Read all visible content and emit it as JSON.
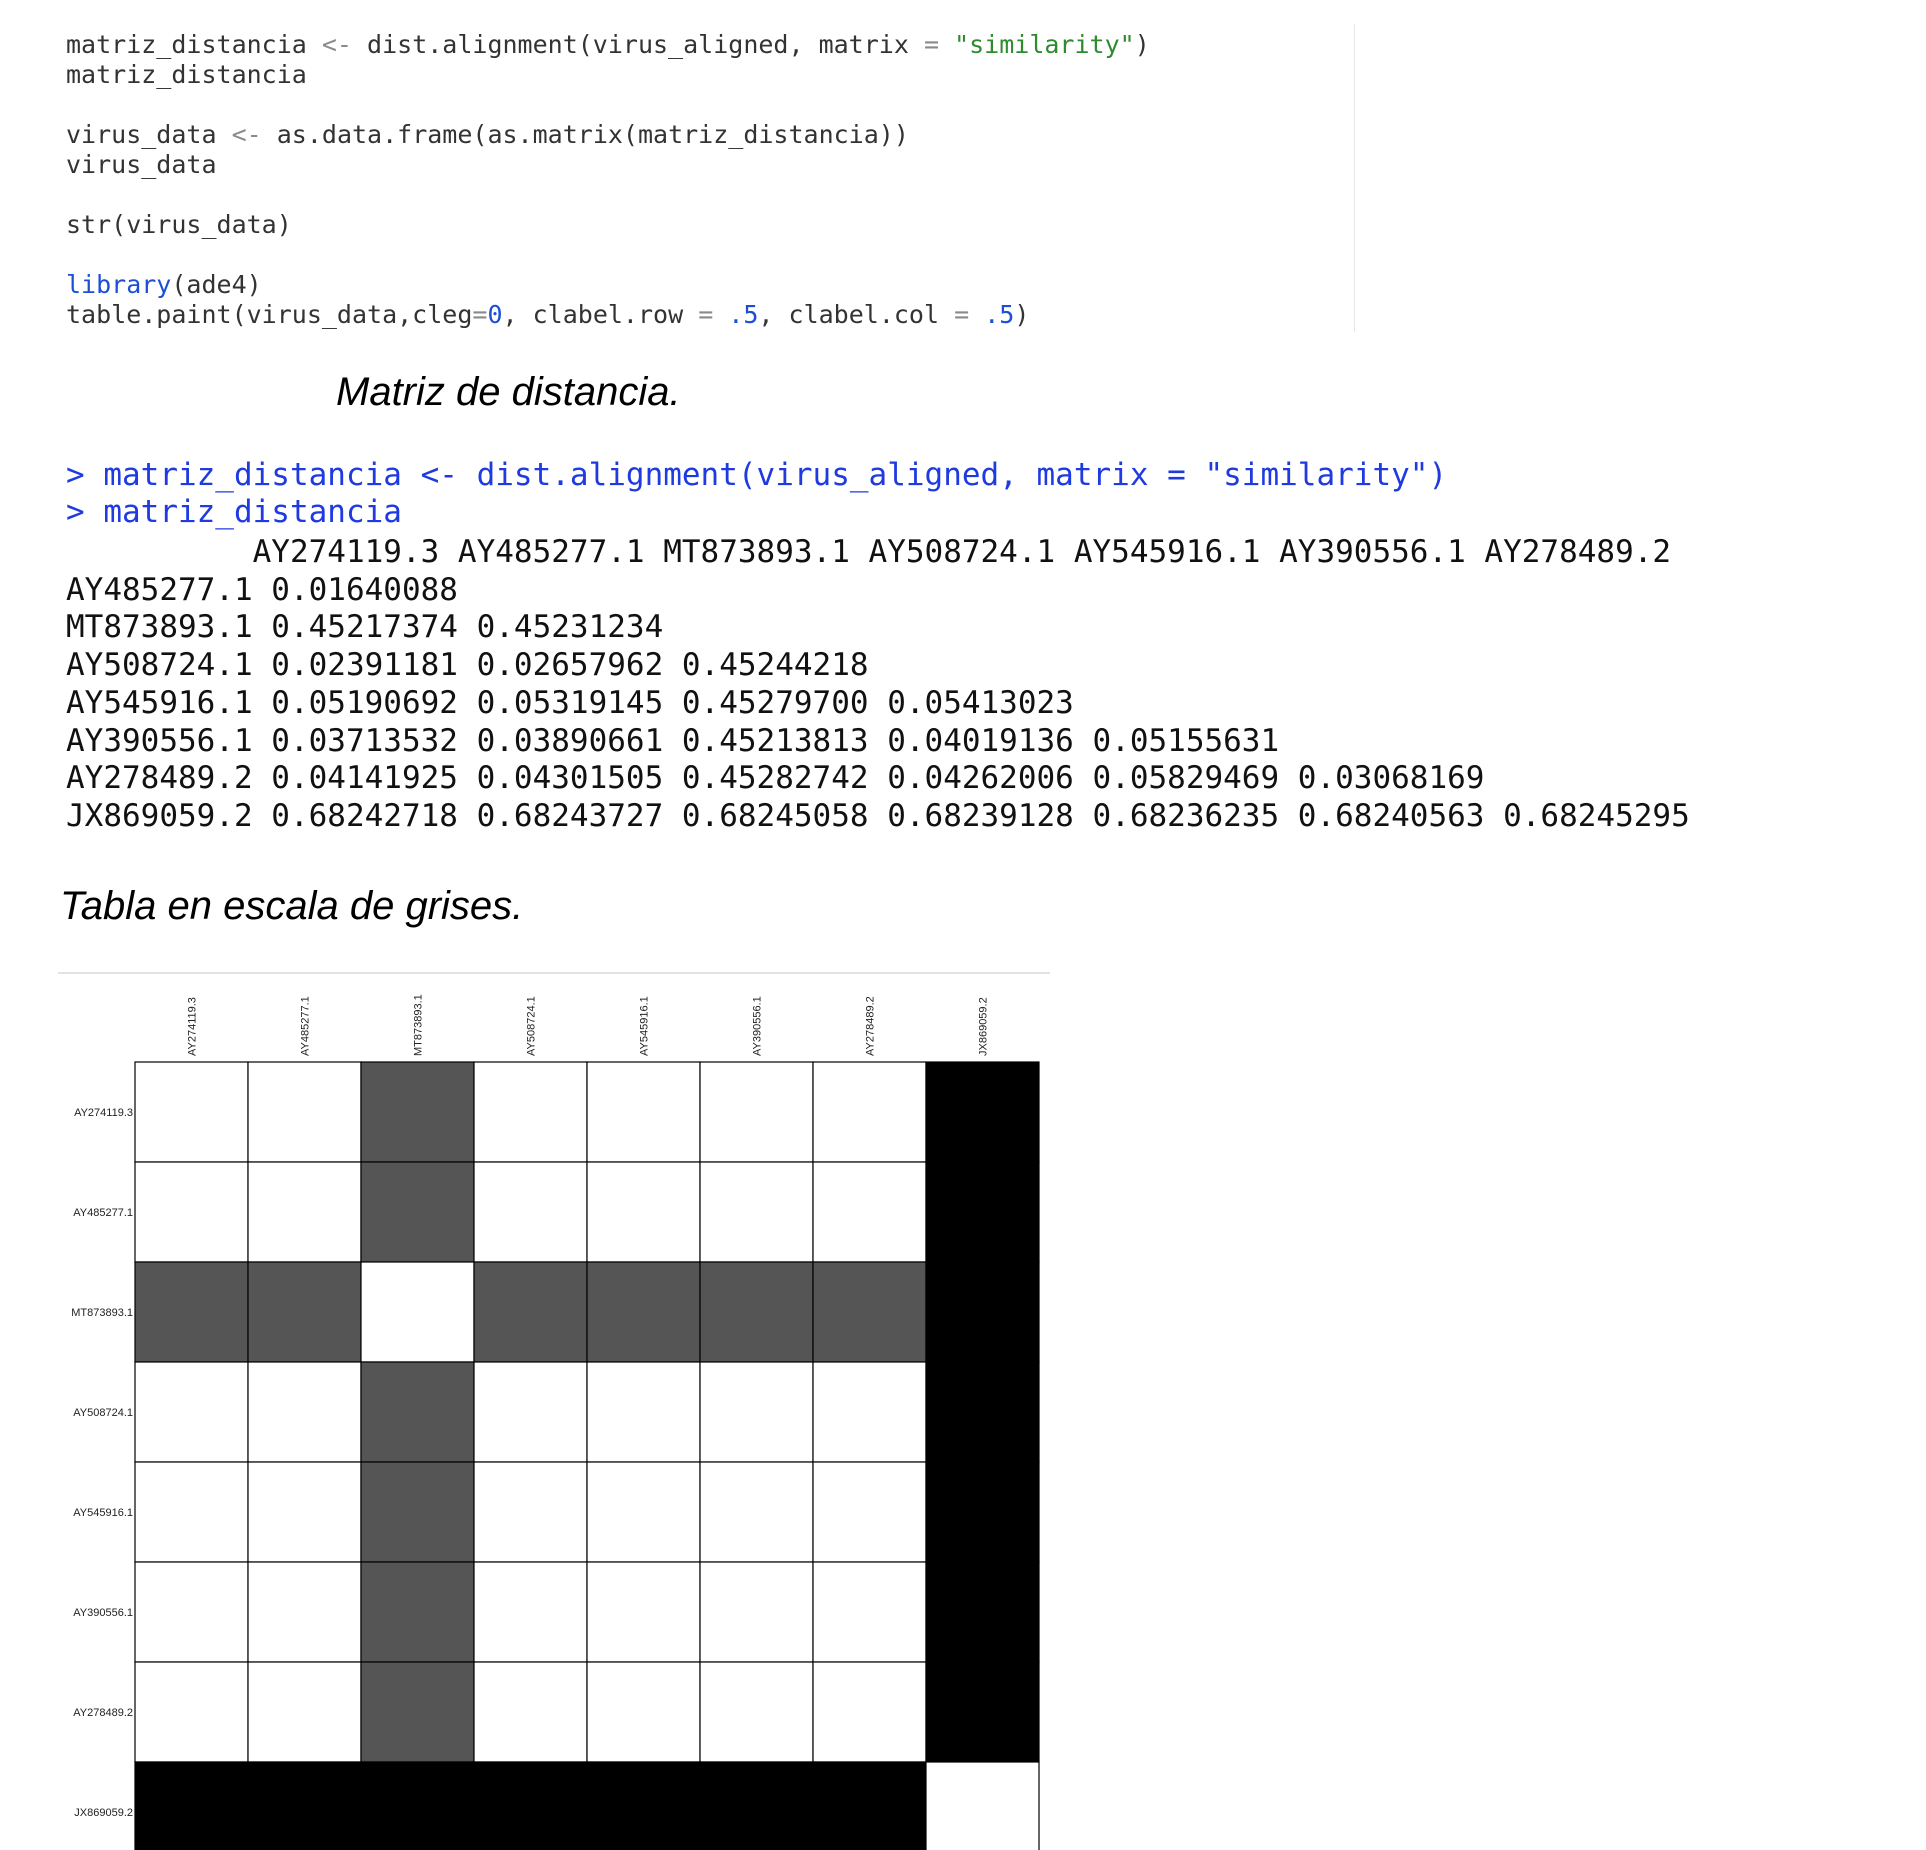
{
  "editor": {
    "lines": [
      {
        "parts": [
          {
            "t": "matriz_distancia ",
            "c": ""
          },
          {
            "t": "<-",
            "c": "tok-op"
          },
          {
            "t": " dist.alignment(virus_aligned, matrix ",
            "c": ""
          },
          {
            "t": "=",
            "c": "tok-op"
          },
          {
            "t": " ",
            "c": ""
          },
          {
            "t": "\"similarity\"",
            "c": "tok-str"
          },
          {
            "t": ")",
            "c": ""
          }
        ]
      },
      {
        "parts": [
          {
            "t": "matriz_distancia",
            "c": ""
          }
        ]
      },
      {
        "parts": []
      },
      {
        "parts": [
          {
            "t": "virus_data ",
            "c": ""
          },
          {
            "t": "<-",
            "c": "tok-op"
          },
          {
            "t": " as.data.frame(as.matrix(matriz_distancia))",
            "c": ""
          }
        ]
      },
      {
        "parts": [
          {
            "t": "virus_data",
            "c": ""
          }
        ]
      },
      {
        "parts": []
      },
      {
        "parts": [
          {
            "t": "str(virus_data)",
            "c": ""
          }
        ]
      },
      {
        "parts": []
      },
      {
        "parts": [
          {
            "t": "library",
            "c": "tok-fn"
          },
          {
            "t": "(ade4)",
            "c": ""
          }
        ]
      },
      {
        "parts": [
          {
            "t": "table.paint(virus_data,cleg",
            "c": ""
          },
          {
            "t": "=",
            "c": "tok-op"
          },
          {
            "t": "0",
            "c": "tok-num"
          },
          {
            "t": ", clabel.row ",
            "c": ""
          },
          {
            "t": "=",
            "c": "tok-op"
          },
          {
            "t": " ",
            "c": ""
          },
          {
            "t": ".5",
            "c": "tok-num"
          },
          {
            "t": ", clabel.col ",
            "c": ""
          },
          {
            "t": "=",
            "c": "tok-op"
          },
          {
            "t": " ",
            "c": ""
          },
          {
            "t": ".5",
            "c": "tok-num"
          },
          {
            "t": ")",
            "c": ""
          }
        ]
      }
    ]
  },
  "captions": {
    "matrix": "Matriz de distancia.",
    "table": "Tabla en escala de grises."
  },
  "console": {
    "commands": [
      "> matriz_distancia <- dist.alignment(virus_aligned, matrix = \"similarity\")",
      "> matriz_distancia"
    ],
    "output": [
      "          AY274119.3 AY485277.1 MT873893.1 AY508724.1 AY545916.1 AY390556.1 AY278489.2",
      "AY485277.1 0.01640088",
      "MT873893.1 0.45217374 0.45231234",
      "AY508724.1 0.02391181 0.02657962 0.45244218",
      "AY545916.1 0.05190692 0.05319145 0.45279700 0.05413023",
      "AY390556.1 0.03713532 0.03890661 0.45213813 0.04019136 0.05155631",
      "AY278489.2 0.04141925 0.04301505 0.45282742 0.04262006 0.05829469 0.03068169",
      "JX869059.2 0.68242718 0.68243727 0.68245058 0.68239128 0.68236235 0.68240563 0.68245295"
    ]
  },
  "colors": {
    "command": "#1e3ae0",
    "string": "#2e8b2e",
    "number": "#1c4fd6",
    "cell_low": "#ffffff",
    "cell_mid": "#555555",
    "cell_high": "#000000"
  },
  "chart_data": {
    "type": "heatmap",
    "title": "",
    "row_labels": [
      "AY274119.3",
      "AY485277.1",
      "MT873893.1",
      "AY508724.1",
      "AY545916.1",
      "AY390556.1",
      "AY278489.2",
      "JX869059.2"
    ],
    "col_labels": [
      "AY274119.3",
      "AY485277.1",
      "MT873893.1",
      "AY508724.1",
      "AY545916.1",
      "AY390556.1",
      "AY278489.2",
      "JX869059.2"
    ],
    "grayscale": true,
    "values": [
      [
        0,
        0.01640088,
        0.45217374,
        0.02391181,
        0.05190692,
        0.03713532,
        0.04141925,
        0.68242718
      ],
      [
        0.01640088,
        0,
        0.45231234,
        0.02657962,
        0.05319145,
        0.03890661,
        0.04301505,
        0.68243727
      ],
      [
        0.45217374,
        0.45231234,
        0,
        0.45244218,
        0.452797,
        0.45213813,
        0.45282742,
        0.68245058
      ],
      [
        0.02391181,
        0.02657962,
        0.45244218,
        0,
        0.05413023,
        0.04019136,
        0.04262006,
        0.68239128
      ],
      [
        0.05190692,
        0.05319145,
        0.452797,
        0.05413023,
        0,
        0.05155631,
        0.05829469,
        0.68236235
      ],
      [
        0.03713532,
        0.03890661,
        0.45213813,
        0.04019136,
        0.05155631,
        0,
        0.03068169,
        0.68240563
      ],
      [
        0.04141925,
        0.04301505,
        0.45282742,
        0.04262006,
        0.05829469,
        0.03068169,
        0,
        0.68245295
      ],
      [
        0.68242718,
        0.68243727,
        0.68245058,
        0.68239128,
        0.68236235,
        0.68240563,
        0.68245295,
        0
      ]
    ]
  }
}
